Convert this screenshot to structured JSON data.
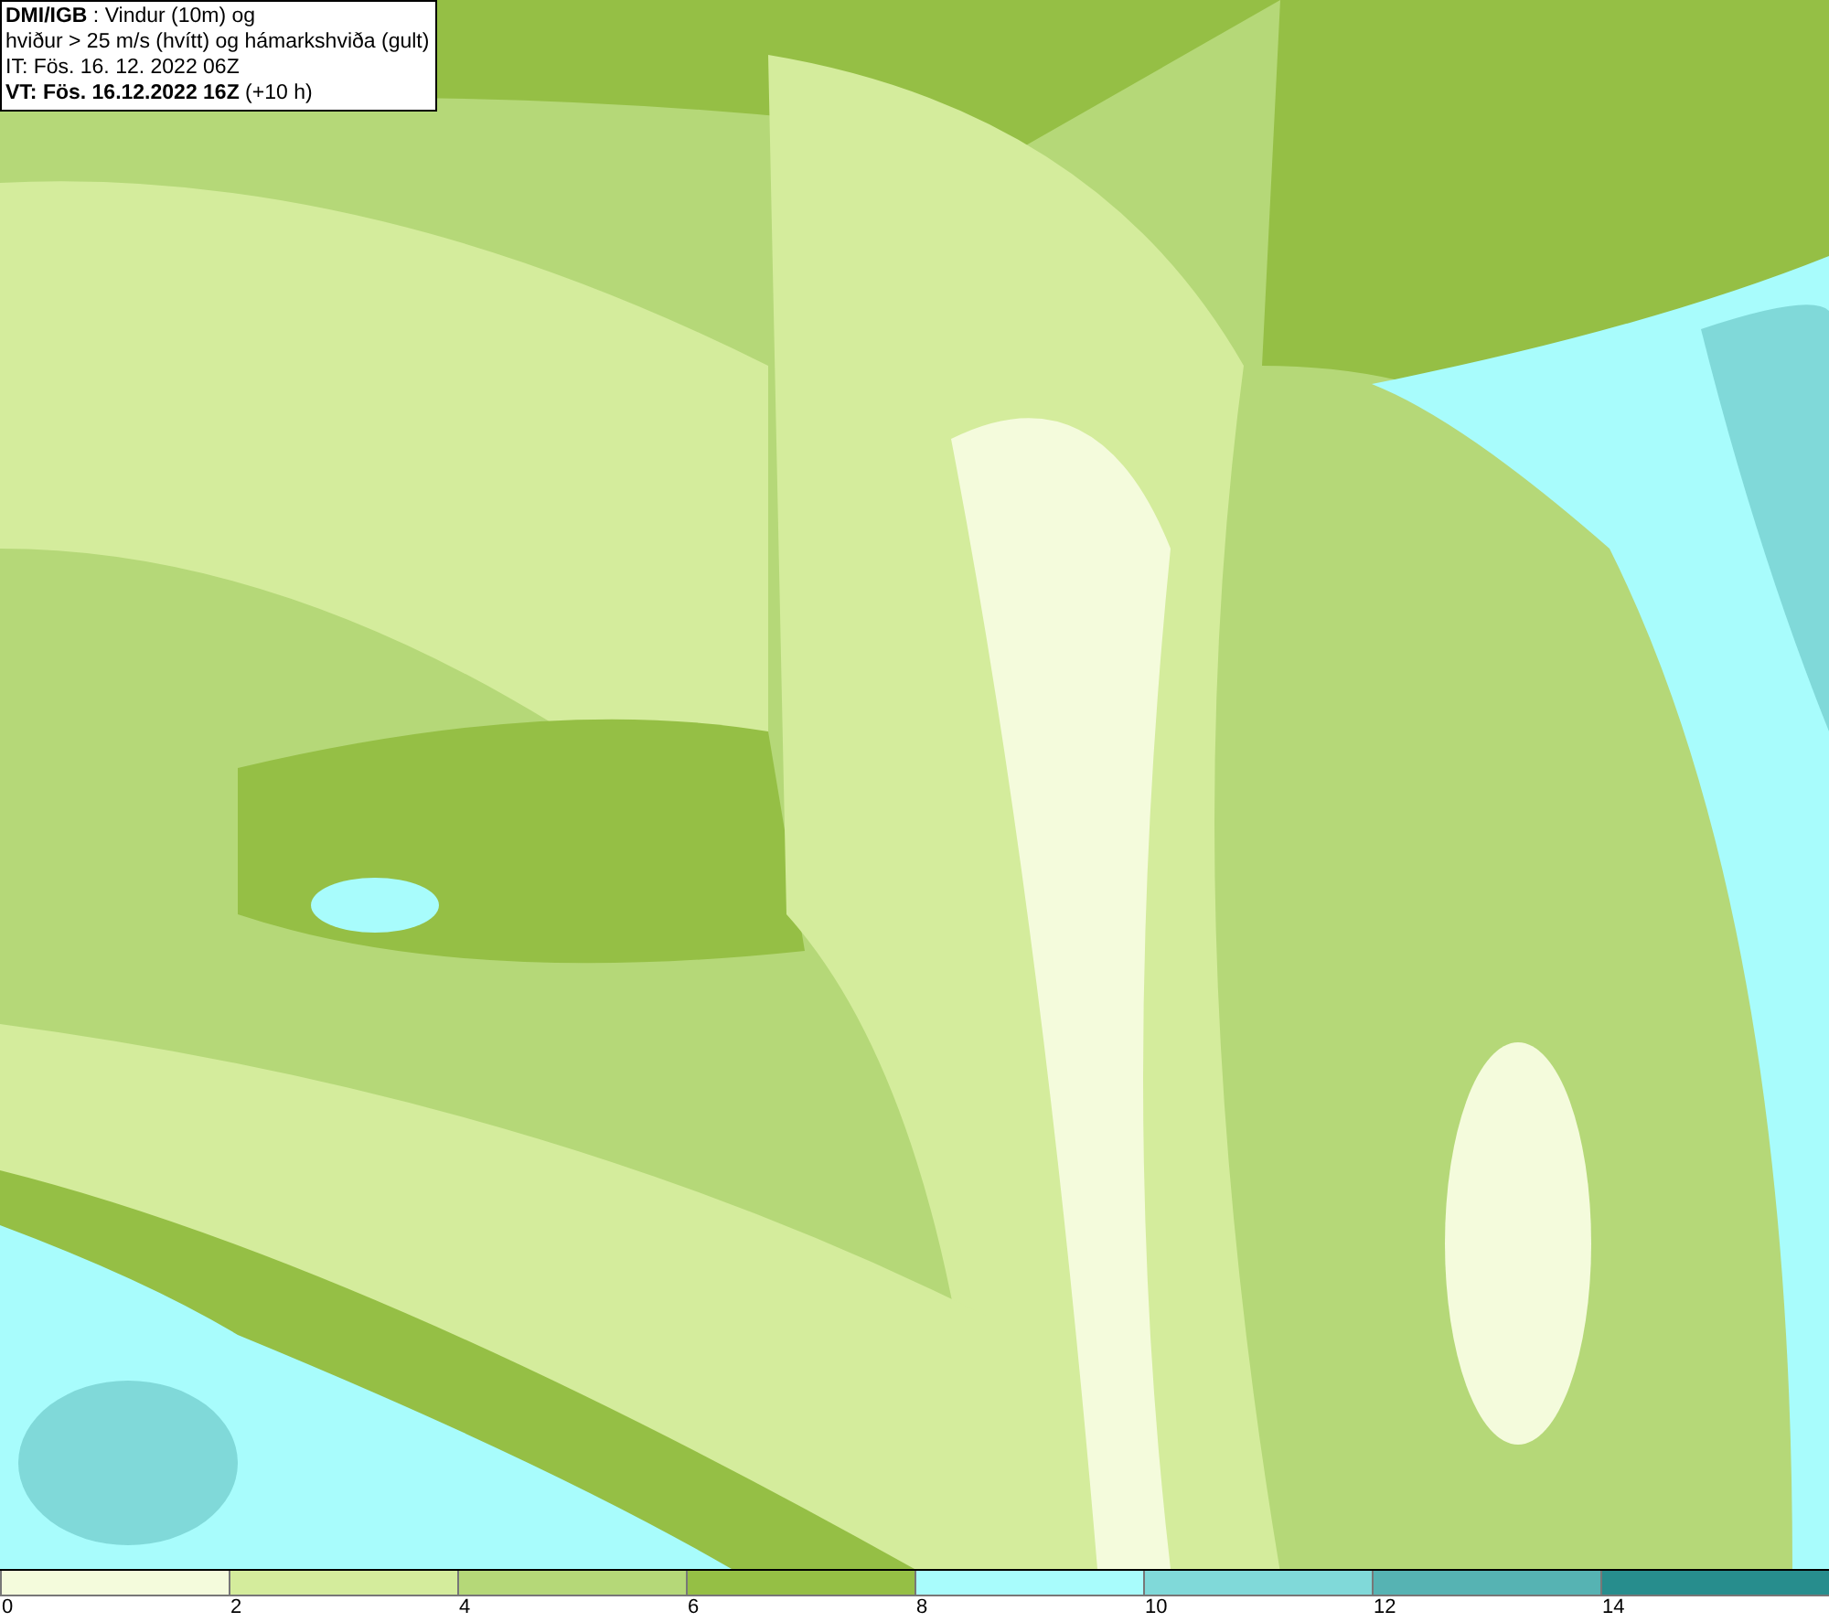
{
  "title_box": {
    "lines": [
      "**DMI/IGB** : Vindur (10m) og",
      "hviður > 25 m/s (hvítt) og hámarkshviða (gult)",
      "IT: Fös. 16. 12. 2022 06Z",
      "**VT: Fös. 16.12.2022 16Z** (+10 h)"
    ]
  },
  "legend": {
    "bins": [
      {
        "color": "#f4fbdc"
      },
      {
        "color": "#d4ec9c"
      },
      {
        "color": "#b5d878"
      },
      {
        "color": "#95bf45"
      },
      {
        "color": "#a8fcfc"
      },
      {
        "color": "#80d9d9"
      },
      {
        "color": "#56b3b3"
      },
      {
        "color": "#278d8d"
      }
    ],
    "ticks": [
      "0",
      "2",
      "4",
      "6",
      "8",
      "10",
      "12",
      "14"
    ]
  }
}
